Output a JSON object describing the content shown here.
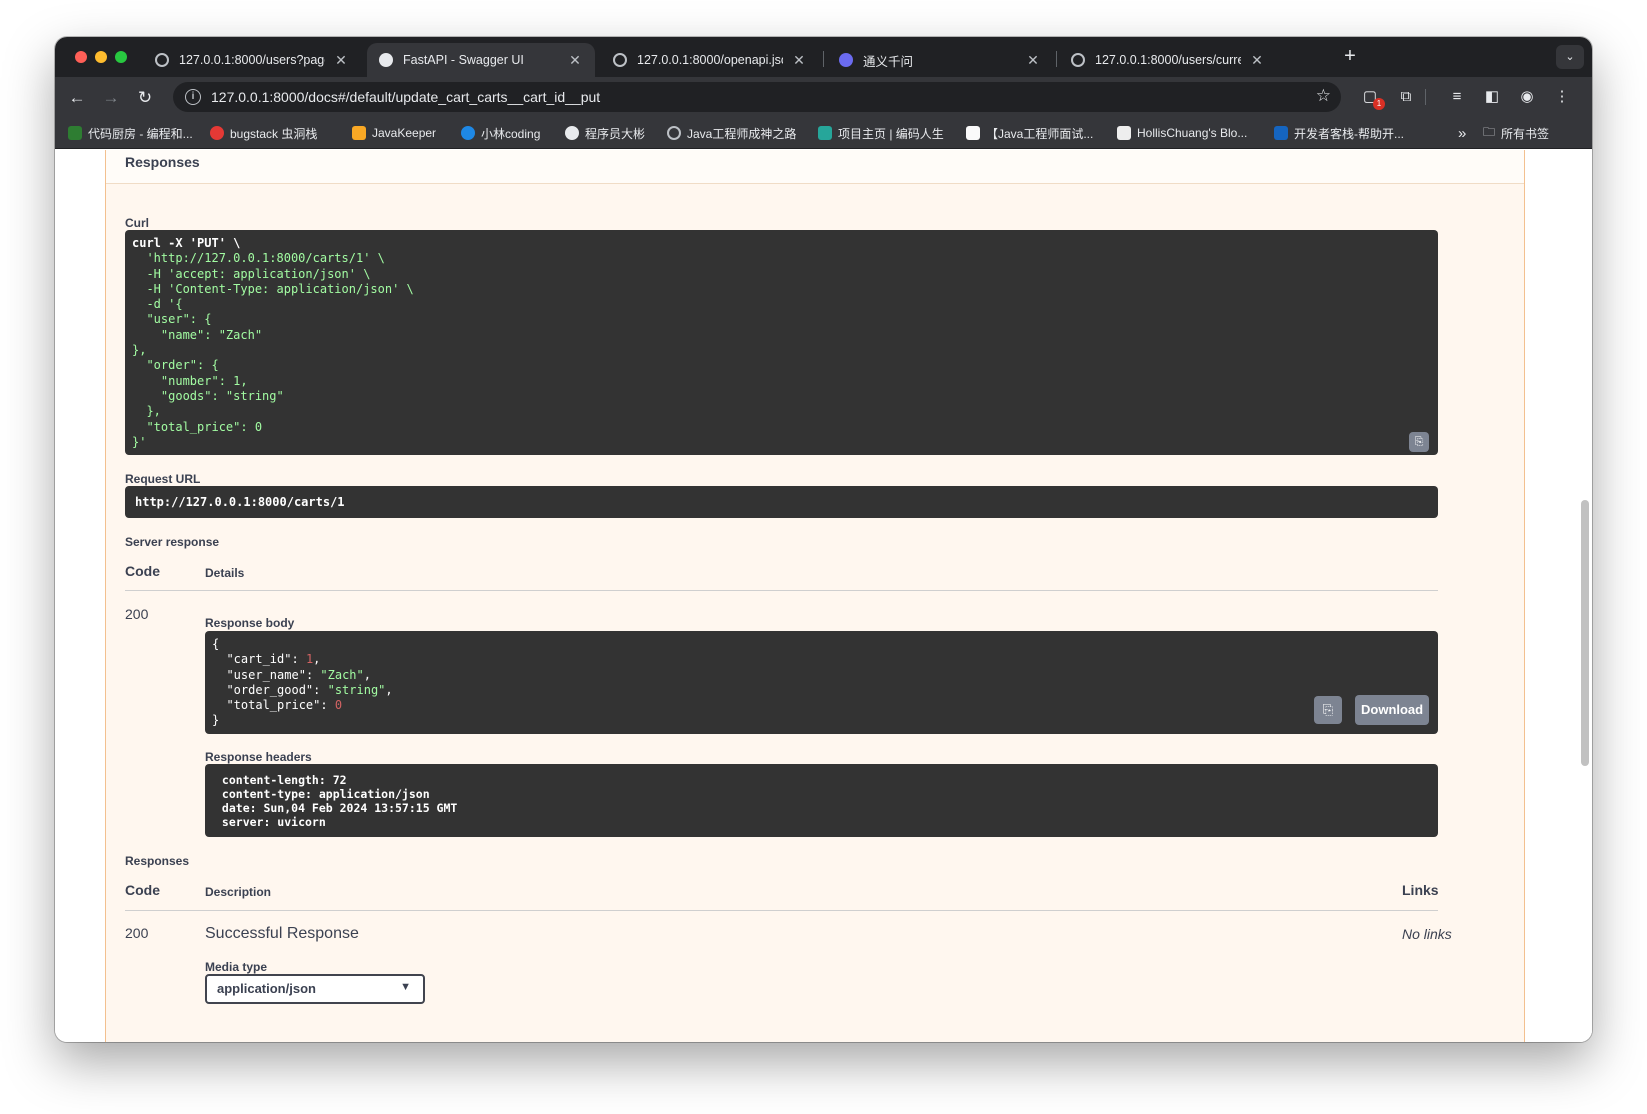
{
  "browser": {
    "tabs": [
      {
        "title": "127.0.0.1:8000/users?page_li",
        "active": false
      },
      {
        "title": "FastAPI - Swagger UI",
        "active": true
      },
      {
        "title": "127.0.0.1:8000/openapi.json",
        "active": false
      },
      {
        "title": "通义千问",
        "active": false
      },
      {
        "title": "127.0.0.1:8000/users/current",
        "active": false
      }
    ],
    "new_tab": "+",
    "url": "127.0.0.1:8000/docs#/default/update_cart_carts__cart_id__put",
    "extension_badge": "1",
    "bookmarks": [
      "代码厨房 - 编程和...",
      "bugstack 虫洞栈",
      "JavaKeeper",
      "小林coding",
      "程序员大彬",
      "Java工程师成神之路",
      "项目主页 | 编码人生",
      "【Java工程师面试...",
      "HollisChuang's Blo...",
      "开发者客栈-帮助开..."
    ],
    "bookmarks_overflow": "»",
    "all_bookmarks": "所有书签"
  },
  "colors": {
    "put_border": "#f3c08f",
    "put_bg": "#fff7ef",
    "code_bg": "#333333",
    "string": "#a2fca2",
    "number": "#d36363"
  },
  "swagger": {
    "responses_header": "Responses",
    "curl_label": "Curl",
    "curl_lines": [
      "curl -X 'PUT' \\",
      "  'http://127.0.0.1:8000/carts/1' \\",
      "  -H 'accept: application/json' \\",
      "  -H 'Content-Type: application/json' \\",
      "  -d '{",
      "  \"user\": {",
      "    \"name\": \"Zach\"",
      "},",
      "  \"order\": {",
      "    \"number\": 1,",
      "    \"goods\": \"string\"",
      "  },",
      "  \"total_price\": 0",
      "}'"
    ],
    "request_url_label": "Request URL",
    "request_url": "http://127.0.0.1:8000/carts/1",
    "server_response_label": "Server response",
    "code_col": "Code",
    "details_col": "Details",
    "status_code": "200",
    "response_body_label": "Response body",
    "response_body": {
      "open": "{",
      "cart_id_key": "\"cart_id\"",
      "cart_id_val": "1",
      "user_name_key": "\"user_name\"",
      "user_name_val": "\"Zach\"",
      "order_good_key": "\"order_good\"",
      "order_good_val": "\"string\"",
      "total_price_key": "\"total_price\"",
      "total_price_val": "0",
      "close": "}"
    },
    "download_label": "Download",
    "response_headers_label": "Response headers",
    "response_headers": [
      " content-length: 72 ",
      " content-type: application/json ",
      " date: Sun,04 Feb 2024 13:57:15 GMT ",
      " server: uvicorn "
    ],
    "responses_label": "Responses",
    "description_col": "Description",
    "links_col": "Links",
    "resp_code": "200",
    "resp_description": "Successful Response",
    "no_links": "No links",
    "media_type_label": "Media type",
    "media_type_value": "application/json"
  }
}
